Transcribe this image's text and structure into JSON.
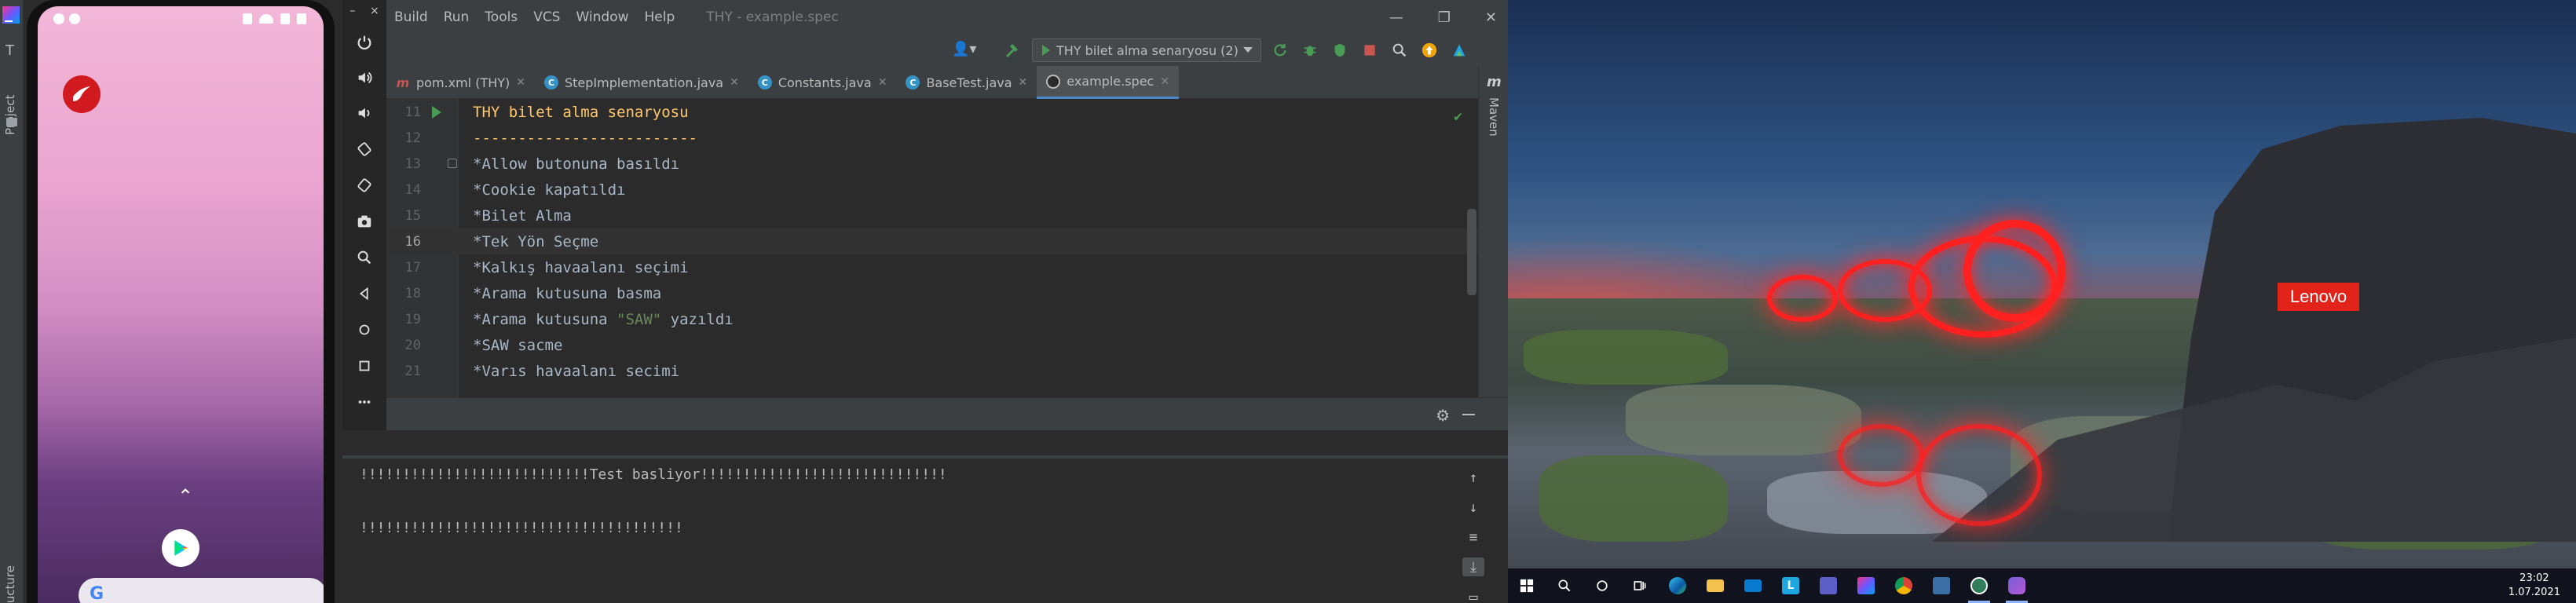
{
  "ide": {
    "menu": [
      "Build",
      "Run",
      "Tools",
      "VCS",
      "Window",
      "Help"
    ],
    "window_title": "THY - example.spec",
    "run_config": "THY bilet alma senaryosu (2)",
    "tabs": [
      {
        "label": "pom.xml (THY)",
        "icon": "maven-icon",
        "active": false
      },
      {
        "label": "StepImplementation.java",
        "icon": "java-class-icon",
        "active": false
      },
      {
        "label": "Constants.java",
        "icon": "java-class-icon",
        "active": false
      },
      {
        "label": "BaseTest.java",
        "icon": "java-class-icon",
        "active": false
      },
      {
        "label": "example.spec",
        "icon": "spec-file-icon",
        "active": true
      }
    ],
    "right_strip_label": "Maven",
    "left_strip": {
      "project_label": "Project",
      "structure_label": "Structure"
    },
    "editor_lines": [
      {
        "n": "11",
        "text": "THY bilet alma senaryosu",
        "kind": "heading"
      },
      {
        "n": "12",
        "text": "-------------------------",
        "kind": "heading"
      },
      {
        "n": "13",
        "text": "*Allow butonuna basıldı",
        "kind": "step"
      },
      {
        "n": "14",
        "text": "*Cookie kapatıldı",
        "kind": "step"
      },
      {
        "n": "15",
        "text": "*Bilet Alma",
        "kind": "step"
      },
      {
        "n": "16",
        "text": "*Tek Yön Seçme",
        "kind": "step"
      },
      {
        "n": "17",
        "text": "*Kalkış havaalanı seçimi",
        "kind": "step"
      },
      {
        "n": "18",
        "text": "*Arama kutusuna basma",
        "kind": "step"
      },
      {
        "n": "19",
        "pre": "*Arama kutusuna ",
        "str": "\"SAW\"",
        "post": " yazıldı",
        "kind": "step-string"
      },
      {
        "n": "20",
        "text": "*SAW sacme",
        "kind": "step"
      },
      {
        "n": "21",
        "text": "*Varıs havaalanı secimi",
        "kind": "step"
      }
    ],
    "current_line": "16",
    "console_lines": [
      "!!!!!!!!!!!!!!!!!!!!!!!!!!!Test basliyor!!!!!!!!!!!!!!!!!!!!!!!!!!!!!",
      "!!!!!!!!!!!!!!!!!!!!!!!!!!!!!!!!!!!!!!"
    ],
    "colors": {
      "bg": "#2b2b2b",
      "panel": "#3c3f41",
      "accent": "#4a88c7",
      "run_green": "#499c54",
      "heading": "#ffc66d",
      "string": "#6a8759"
    }
  },
  "emulator": {
    "window_controls": [
      "–",
      "×"
    ],
    "tools": [
      "power-icon",
      "volume-up-icon",
      "volume-down-icon",
      "rotate-left-icon",
      "rotate-right-icon",
      "camera-icon",
      "zoom-icon",
      "back-icon",
      "home-icon",
      "overview-icon",
      "more-icon"
    ],
    "search_glyph": "G"
  },
  "desktop": {
    "brand_label": "Lenovo",
    "clock_time": "23:02",
    "clock_date": "1.07.2021",
    "taskbar_apps": [
      "windows-start-icon",
      "search-icon",
      "cortana-icon",
      "task-view-icon",
      "edge-icon",
      "file-explorer-icon",
      "mail-icon",
      "l-app-icon",
      "teams-icon",
      "intellij-icon",
      "chrome-icon",
      "store-icon",
      "android-studio-icon",
      "emulator-icon"
    ]
  }
}
